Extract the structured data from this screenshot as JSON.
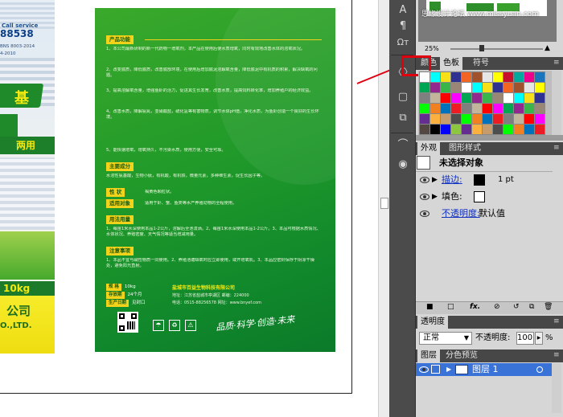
{
  "watermark": "思缘设计论坛 www.missyuan.com",
  "package": {
    "service_label": "Call service",
    "phone": "88538",
    "code": "BNS 8003-2014",
    "code_lines": "4-2010",
    "mid_text": "两用",
    "weight": "10kg",
    "company": "公司",
    "company_en": "O.,LTD."
  },
  "leaflet": {
    "sections": {
      "features": "产品功能",
      "ingredients": "主要成分",
      "properties": "性    状",
      "properties_value": "褐黄色颗粒状。",
      "targets": "适用对象",
      "dosage": "用法用量",
      "notes": "注意事项"
    },
    "para1": "1、本公司最新研制的新一代药物一增氧剂，本产品在使用后使水质增氧，同时有效地改善水体的溶氧状况。",
    "para2": "2、改变底质，降低底质，改善底部环境，在使用后增加底泥溶解氧含量，降低底泥中有机质的积累，解决缺氧的问题。",
    "para3": "3、提高溶解氧含量，增强鱼虾的活力，促进其生长发育，改善水质，提高饲料转化率，增加养殖户的经济效益。",
    "para4": "4、改善水质，降解氨氮，亚硝酸盐，硫化氢等有害物质，调节水体pH值，净化水质，为鱼虾创造一个良好的生长环境。",
    "para5": "5、能快速增氧，增氧持久，不污染水质，使用方便，安全可靠。",
    "ingredients_value": "水溶性氨基酸，生物小肽，有机酸，有机铁，微量元素，多种维生素，促生长因子等。",
    "targets_value": "适用于虾、蟹、鱼类等水产养殖动物的全程使用。",
    "dosage_text": "1、每亩1米水深使用本品1-2公斤，溶解后全池泼洒。2、每亩1米水深使用本品1-2公斤。3、本品可根据水质情况、水体状况、养殖密度、天气情况等适当增减用量。",
    "notes_text": "1、本品不宜与碱性物质一同使用。2、养殖池塘缺氧时应立即使用，或开增氧机。3、本品应密封保存于阴凉干燥处，避免阳光直射。",
    "specs": {
      "net_label": "规    格",
      "net_value": "10kg",
      "storage_label": "存放期",
      "storage_value": "24个月",
      "date_label": "生产日期",
      "date_value": "见封口"
    },
    "company": "盐城市百益生物科技有限公司",
    "address": "地址：江苏省盐城市亭湖区      邮编：224000",
    "phone": "电话：0515-88256578   网址：www.bnyef.com",
    "slogan": "品质·科学·创造·未来"
  },
  "tools": [
    "A",
    "¶",
    "Ωт",
    "⎔",
    "▢",
    "⧉",
    "⌒",
    "◉"
  ],
  "zoom": "25%",
  "swatch_tabs": [
    "颜色",
    "色板",
    "符号"
  ],
  "appearance": {
    "tabs": [
      "外观",
      "图形样式"
    ],
    "no_selection": "未选择对象",
    "stroke_label": "描边:",
    "stroke_value": "1 pt",
    "fill_label": "填色:",
    "opacity_label": "不透明度:",
    "opacity_value": "默认值",
    "footer_icons": [
      "■",
      "□",
      "fx.",
      "⊘",
      "↺",
      "⧉",
      "🗑"
    ]
  },
  "transparency": {
    "tab": "透明度",
    "mode": "正常",
    "opacity_label": "不透明度:",
    "opacity_value": "100",
    "opacity_unit": "%"
  },
  "layers": {
    "tabs": [
      "图层",
      "分色预览"
    ],
    "layer_name": "图层 1"
  },
  "colors": {
    "accent_red": "#e2000f",
    "leaflet_green": "#1a9a2a",
    "layer_highlight": "#3a73d8"
  }
}
